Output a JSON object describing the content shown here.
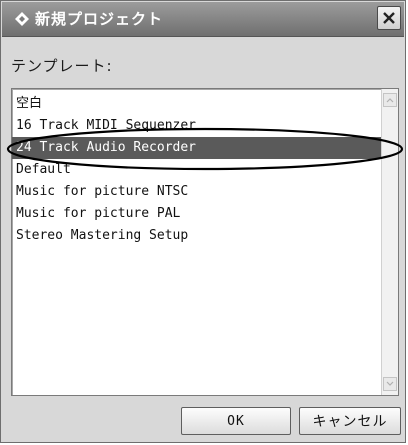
{
  "window": {
    "title": "新規プロジェクト",
    "title_icon": "diamond-icon",
    "close_icon": "close-icon"
  },
  "template_label": "テンプレート:",
  "templates": {
    "items": [
      "空白",
      "16 Track MIDI Sequenzer",
      "24 Track Audio Recorder",
      "Default",
      "Music for picture NTSC",
      "Music for picture PAL",
      "Stereo Mastering Setup"
    ],
    "selected": "24 Track Audio Recorder"
  },
  "buttons": {
    "ok": "OK",
    "cancel": "キャンセル"
  },
  "colors": {
    "selection": "#5a5a5a",
    "titlebar": "#7d7d7d"
  }
}
